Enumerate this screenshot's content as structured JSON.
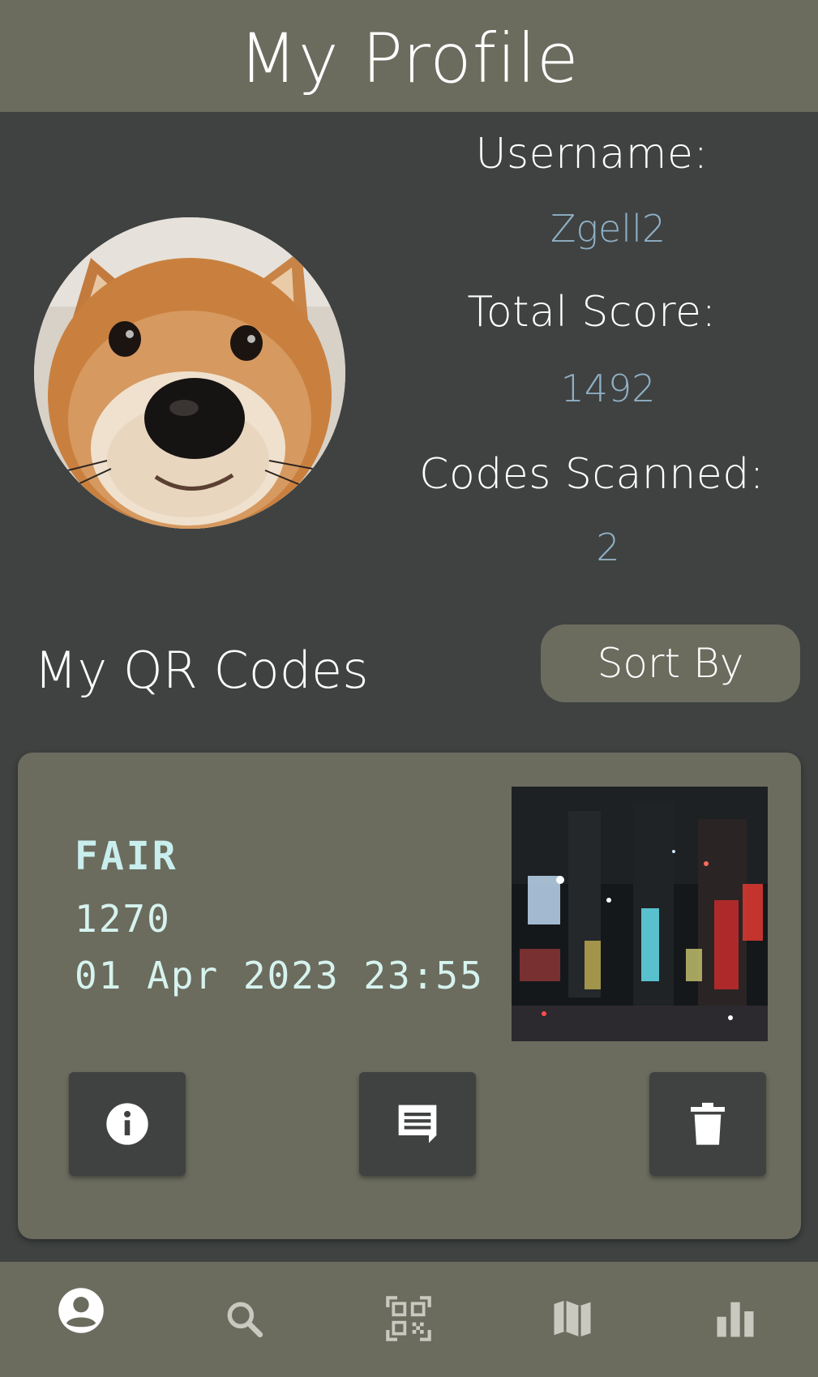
{
  "header": {
    "title": "My Profile"
  },
  "profile": {
    "username_label": "Username:",
    "username": "Zgell2",
    "score_label": "Total Score:",
    "score": "1492",
    "codes_label": "Codes Scanned:",
    "codes": "2"
  },
  "qr_section": {
    "title": "My QR Codes",
    "sort_label": "Sort By"
  },
  "qr_card": {
    "rarity": "FAIR",
    "score": "1270",
    "date": "01 Apr 2023 23:55",
    "buttons": [
      "info-icon",
      "comment-icon",
      "trash-icon"
    ]
  },
  "bottom_nav": {
    "items": [
      "profile-icon",
      "search-icon",
      "qr-scan-icon",
      "map-icon",
      "leaderboard-icon"
    ],
    "active": "profile-icon"
  },
  "colors": {
    "header_bg": "#6b6c5e",
    "page_bg": "#3f4241",
    "accent_value": "#8fb0c6",
    "card_bg": "#6b6c5e"
  }
}
